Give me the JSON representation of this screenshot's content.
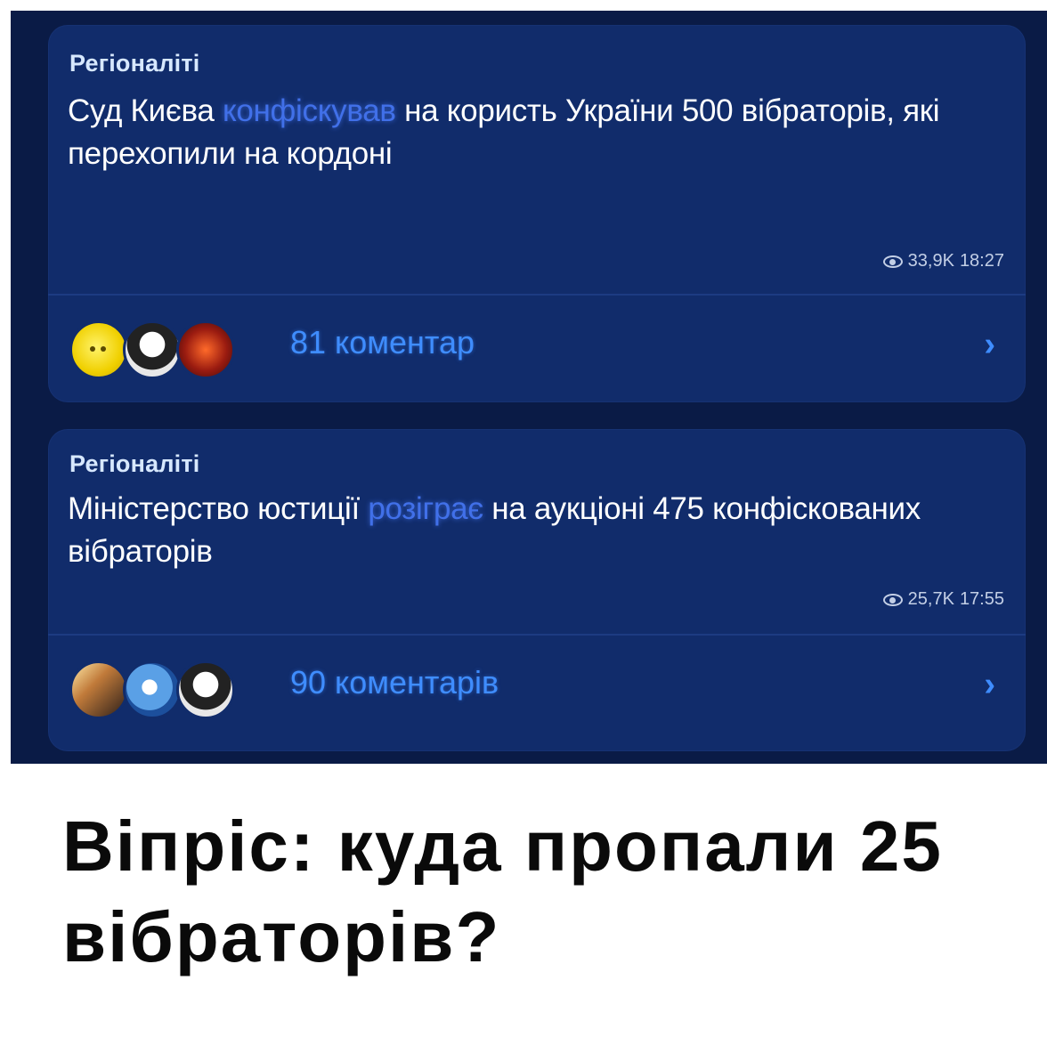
{
  "posts": [
    {
      "channel": "Регіоналіті",
      "message_before": "Суд Києва ",
      "message_spoiler": "конфіскував",
      "message_after": " на користь України 500 вібраторів, які перехопили на кордоні",
      "views": "33,9K",
      "time": "18:27",
      "comments_label": "81 коментар",
      "avatars": [
        "yellow-smiley-avatar",
        "bw-avatar",
        "red-avatar"
      ]
    },
    {
      "channel": "Регіоналіті",
      "message_before": "Міністерство юстиції ",
      "message_spoiler": "розіграє",
      "message_after": " на аукціоні 475 конфіскованих вібраторів",
      "views": "25,7K",
      "time": "17:55",
      "comments_label": "90 коментарів",
      "avatars": [
        "photo-avatar",
        "cartoon-avatar",
        "bw-avatar"
      ]
    }
  ],
  "chevron_glyph": "›",
  "caption": "Віпріс: куда пропали 25 вібраторів?",
  "colors": {
    "background": "#0a1b46",
    "bubble": "#112c6b",
    "link_blue": "#3f8dff",
    "spoiler_blue": "#4a7dff",
    "channel_name": "#d7e8ff"
  }
}
